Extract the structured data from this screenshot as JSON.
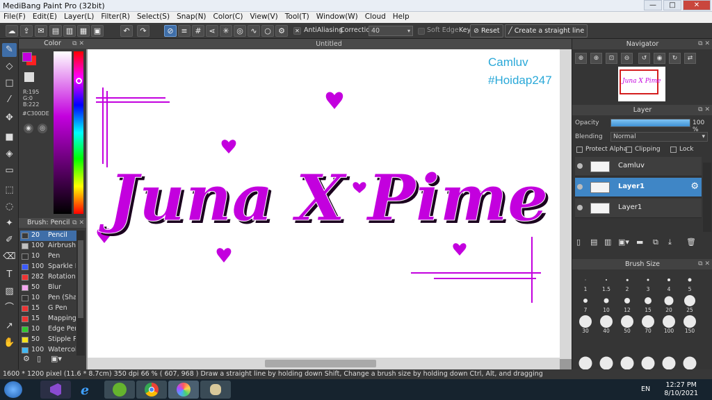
{
  "window": {
    "title": "MediBang Paint Pro (32bit)",
    "controls": [
      "—",
      "□",
      "✕"
    ]
  },
  "menu": [
    "File(F)",
    "Edit(E)",
    "Layer(L)",
    "Filter(R)",
    "Select(S)",
    "Snap(N)",
    "Color(C)",
    "View(V)",
    "Tool(T)",
    "Window(W)",
    "Cloud",
    "Help"
  ],
  "toolbar": {
    "antialiasing": "AntiAliasing",
    "correction_label": "Correction",
    "correction_value": "40",
    "soft_edge": "Soft Edge",
    "key_label": "Key",
    "reset": "Reset",
    "straight_line": "Create a straight line"
  },
  "color_panel": {
    "title": "Color",
    "rgb": [
      "R:195",
      "G:0",
      "B:222"
    ],
    "hex": "#C300DE",
    "primary_color": "#c300de",
    "secondary_color": "#ff2020"
  },
  "brush_panel": {
    "title": "Brush: Pencil",
    "brushes": [
      {
        "size": "20",
        "name": "Pencil",
        "color": "#3a3a3a",
        "selected": true
      },
      {
        "size": "100",
        "name": "Airbrush",
        "color": "#c0c0c0"
      },
      {
        "size": "10",
        "name": "Pen",
        "color": "#333333"
      },
      {
        "size": "100",
        "name": "Sparkle B",
        "color": "#3b5bff"
      },
      {
        "size": "282",
        "name": "Rotation",
        "color": "#e33"
      },
      {
        "size": "50",
        "name": "Blur",
        "color": "#f4a6f0"
      },
      {
        "size": "10",
        "name": "Pen (Sha",
        "color": "#333333"
      },
      {
        "size": "15",
        "name": "G Pen",
        "color": "#e33"
      },
      {
        "size": "15",
        "name": "Mapping",
        "color": "#e33"
      },
      {
        "size": "10",
        "name": "Edge Pen",
        "color": "#2fc72f"
      },
      {
        "size": "50",
        "name": "Stipple Pe",
        "color": "#f5e11b"
      },
      {
        "size": "100",
        "name": "Watercol",
        "color": "#40b8f4"
      }
    ]
  },
  "document": {
    "tab_title": "Untitled",
    "canvas_text_line1": "Camluv",
    "canvas_text_line2": "#Hoidap247",
    "lettering": "Juna X Pime"
  },
  "status_bar": {
    "size": "1600 * 1200 pixel",
    "physical": "(11.6 * 8.7cm)",
    "dpi": "350 dpi",
    "zoom": "66 %",
    "coords": "( 607, 968 )",
    "hint": "Draw a straight line by holding down Shift, Change a brush size by holding down Ctrl, Alt, and dragging"
  },
  "navigator": {
    "title": "Navigator"
  },
  "layer_panel": {
    "title": "Layer",
    "opacity_label": "Opacity",
    "opacity_value": "100 %",
    "opacity_fraction": 1.0,
    "blending_label": "Blending",
    "blending_value": "Normal",
    "protect_alpha": "Protect Alpha",
    "clipping": "Clipping",
    "lock": "Lock",
    "layers": [
      {
        "name": "Camluv",
        "selected": false
      },
      {
        "name": "Layer1",
        "selected": true
      },
      {
        "name": "Layer1",
        "selected": false
      }
    ]
  },
  "brush_size_panel": {
    "title": "Brush Size",
    "sizes": [
      "1",
      "1.5",
      "2",
      "3",
      "4",
      "5",
      "7",
      "10",
      "12",
      "15",
      "20",
      "25",
      "30",
      "40",
      "50",
      "70",
      "100",
      "150"
    ]
  },
  "taskbar": {
    "language": "EN",
    "time": "12:27 PM",
    "date": "8/10/2021"
  },
  "colors": {
    "accent": "#3f86c6",
    "ink": "#c300de"
  }
}
